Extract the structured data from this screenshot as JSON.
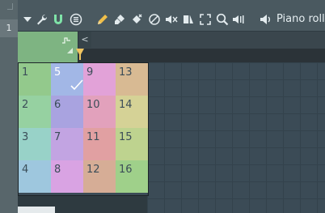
{
  "toolbar": {
    "tools": [
      {
        "name": "dropdown-arrow-icon",
        "glyph": "▼"
      },
      {
        "name": "wrench-icon"
      },
      {
        "name": "magnet-icon"
      },
      {
        "name": "menu-circle-icon"
      },
      {
        "name": "pencil-draw-icon"
      },
      {
        "name": "paint-brush-icon"
      },
      {
        "name": "delete-tool-icon"
      },
      {
        "name": "mute-circle-icon"
      },
      {
        "name": "mute-speaker-icon"
      },
      {
        "name": "slice-tool-icon"
      },
      {
        "name": "select-tool-icon"
      },
      {
        "name": "zoom-tool-icon"
      },
      {
        "name": "playback-tool-icon"
      },
      {
        "name": "speaker-icon"
      }
    ],
    "title": "Piano roll"
  },
  "sidebar": {
    "control_label": "1"
  },
  "header": {
    "arrow_glyph": "<"
  },
  "color_picker": {
    "cells": [
      {
        "n": "1",
        "color": "#93c98c"
      },
      {
        "n": "2",
        "color": "#96d1a1"
      },
      {
        "n": "3",
        "color": "#98d2c8"
      },
      {
        "n": "4",
        "color": "#9ec7de"
      },
      {
        "n": "5",
        "color": "#a2b7e6",
        "selected": true
      },
      {
        "n": "6",
        "color": "#a9a3e0"
      },
      {
        "n": "7",
        "color": "#c2a4e2"
      },
      {
        "n": "8",
        "color": "#d9a3e3"
      },
      {
        "n": "9",
        "color": "#e2a2d8"
      },
      {
        "n": "10",
        "color": "#e2a1bc"
      },
      {
        "n": "11",
        "color": "#e1a0a2"
      },
      {
        "n": "12",
        "color": "#d6ad96"
      },
      {
        "n": "13",
        "color": "#d8ba93"
      },
      {
        "n": "14",
        "color": "#d5d296"
      },
      {
        "n": "15",
        "color": "#bed38f"
      },
      {
        "n": "16",
        "color": "#9fd08a"
      }
    ]
  }
}
